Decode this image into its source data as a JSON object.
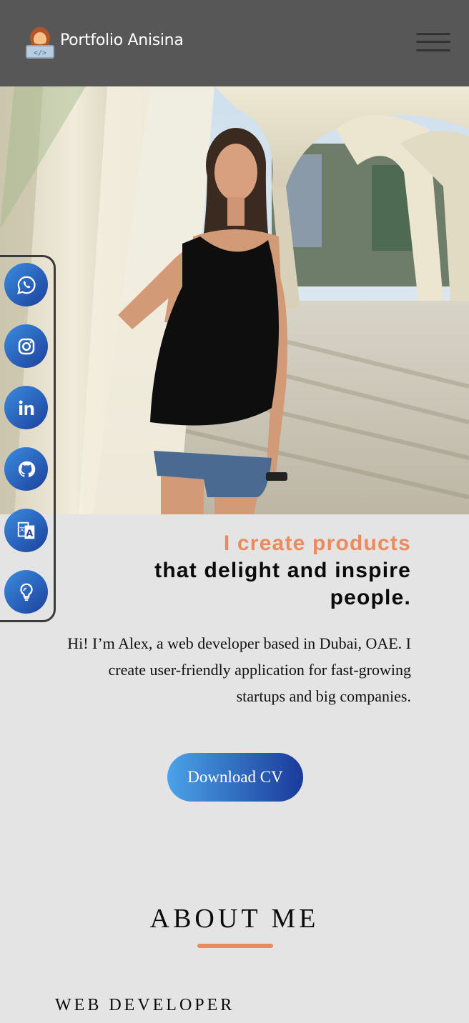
{
  "header": {
    "brand": "Portfolio Anisina",
    "logo_icon": "developer-avatar-icon",
    "menu_icon": "hamburger-menu-icon",
    "background": "#575757"
  },
  "hero": {
    "image_icon": "portrait-photo"
  },
  "social": {
    "items": [
      {
        "name": "whatsapp",
        "icon": "whatsapp-icon"
      },
      {
        "name": "instagram",
        "icon": "instagram-icon"
      },
      {
        "name": "linkedin",
        "icon": "linkedin-icon"
      },
      {
        "name": "github",
        "icon": "github-icon"
      },
      {
        "name": "translate",
        "icon": "translate-icon"
      },
      {
        "name": "idea",
        "icon": "lightbulb-icon"
      }
    ]
  },
  "headline": {
    "accent_line": "I create products",
    "line2": "that delight and inspire",
    "line3": "people."
  },
  "intro": {
    "text": "Hi! I’m Alex, a web developer based in Dubai, OAE. I create user-friendly application for fast-growing startups and big companies."
  },
  "cta": {
    "label": "Download CV"
  },
  "about": {
    "title": "ABOUT ME",
    "subtitle": "WEB DEVELOPER"
  },
  "colors": {
    "accent": "#eb8a5c",
    "button_gradient_start": "#4aa3e8",
    "button_gradient_end": "#1a3a9a",
    "page_background": "#e4e4e4"
  }
}
